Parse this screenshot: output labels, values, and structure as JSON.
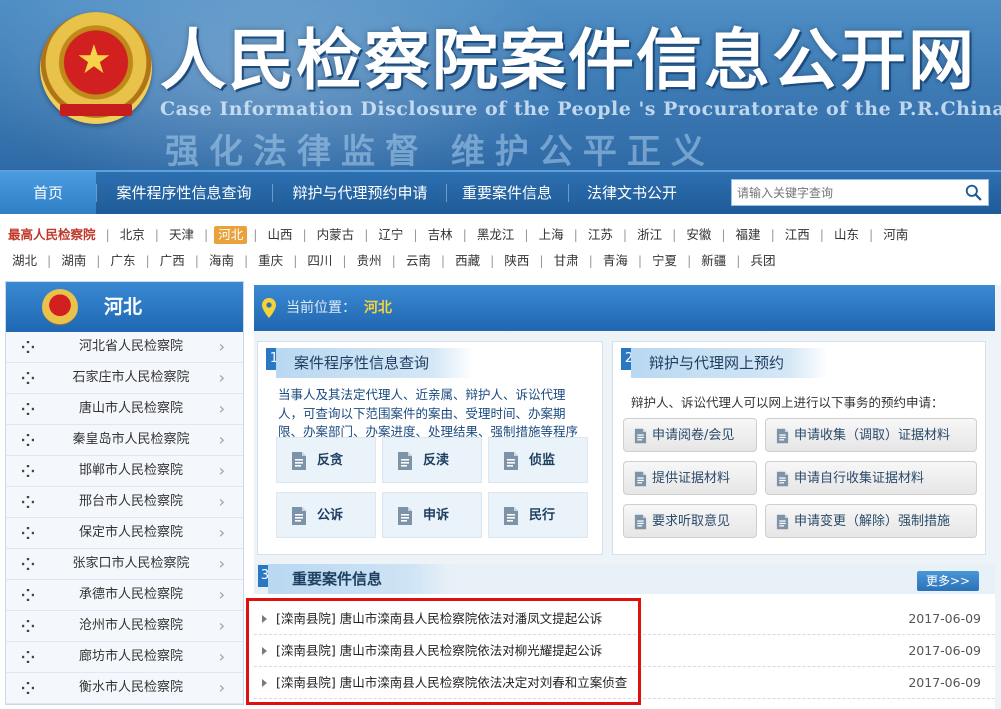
{
  "banner": {
    "title": "人民检察院案件信息公开网",
    "subtitle_en": "Case Information Disclosure of the People 's Procuratorate of the P.R.China",
    "slogan": "强化法律监督  维护公平正义"
  },
  "nav": {
    "items": [
      "首页",
      "案件程序性信息查询",
      "辩护与代理预约申请",
      "重要案件信息",
      "法律文书公开"
    ],
    "search_placeholder": "请输入关键字查询"
  },
  "provinces": {
    "row1": [
      "最高人民检察院",
      "北京",
      "天津",
      "河北",
      "山西",
      "内蒙古",
      "辽宁",
      "吉林",
      "黑龙江",
      "上海",
      "江苏",
      "浙江",
      "安徽",
      "福建",
      "江西",
      "山东",
      "河南"
    ],
    "row2": [
      "湖北",
      "湖南",
      "广东",
      "广西",
      "海南",
      "重庆",
      "四川",
      "贵州",
      "云南",
      "西藏",
      "陕西",
      "甘肃",
      "青海",
      "宁夏",
      "新疆",
      "兵团"
    ],
    "active": "河北"
  },
  "sidebar": {
    "title": "河北",
    "items": [
      "河北省人民检察院",
      "石家庄市人民检察院",
      "唐山市人民检察院",
      "秦皇岛市人民检察院",
      "邯郸市人民检察院",
      "邢台市人民检察院",
      "保定市人民检察院",
      "张家口市人民检察院",
      "承德市人民检察院",
      "沧州市人民检察院",
      "廊坊市人民检察院",
      "衡水市人民检察院"
    ]
  },
  "breadcrumb": {
    "label": "当前位置：",
    "value": "河北"
  },
  "case_query": {
    "num": "1",
    "title": "案件程序性信息查询",
    "desc": "当事人及其法定代理人、近亲属、辩护人、诉讼代理人，可查询以下范围案件的案由、受理时间、办案期限、办案部门、办案进度、处理结果、强制措施等程序性信息。",
    "tiles": [
      "反贪",
      "反渎",
      "侦监",
      "公诉",
      "申诉",
      "民行"
    ]
  },
  "defense": {
    "num": "2",
    "title": "辩护与代理网上预约",
    "desc": "辩护人、诉讼代理人可以网上进行以下事务的预约申请：",
    "buttons": [
      "申请阅卷/会见",
      "申请收集（调取）证据材料",
      "提供证据材料",
      "申请自行收集证据材料",
      "要求听取意见",
      "申请变更（解除）强制措施"
    ]
  },
  "important": {
    "num": "3",
    "title": "重要案件信息",
    "more": "更多>>",
    "news": [
      {
        "title": "[滦南县院] 唐山市滦南县人民检察院依法对潘凤文提起公诉",
        "date": "2017-06-09"
      },
      {
        "title": "[滦南县院] 唐山市滦南县人民检察院依法对柳光耀提起公诉",
        "date": "2017-06-09"
      },
      {
        "title": "[滦南县院] 唐山市滦南县人民检察院依法决定对刘春和立案侦查",
        "date": "2017-06-09"
      }
    ]
  },
  "colors": {
    "brand_blue": "#2066b0",
    "highlight_red": "#e01010",
    "active_province": "#e9a23b",
    "crumb_value": "#f7d33a"
  }
}
